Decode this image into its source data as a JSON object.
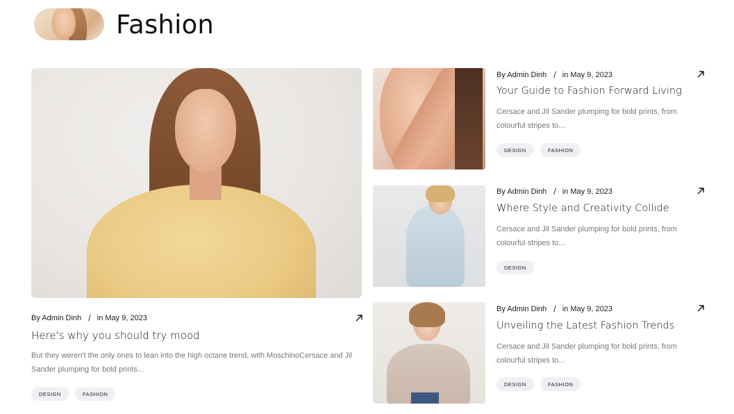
{
  "header": {
    "title": "Fashion"
  },
  "feature": {
    "author": "By Admin Dinh",
    "separator": "/",
    "date": "in May 9, 2023",
    "title": "Here's why you should try mood",
    "excerpt": "But they weren't the only ones to lean into the high octane trend, with MoschinoCersace and Jil Sander plumping for bold prints...",
    "tags": [
      "DESIGN",
      "FASHION"
    ],
    "arrow_icon": "arrow-up-right-icon"
  },
  "posts": [
    {
      "author": "By Admin Dinh",
      "separator": "/",
      "date": "in May 9, 2023",
      "title": "Your Guide to Fashion Forward Living",
      "excerpt": "Cersace and Jil Sander plumping for bold prints, from colourful stripes to...",
      "tags": [
        "DESIGN",
        "FASHION"
      ],
      "arrow_icon": "arrow-up-right-icon"
    },
    {
      "author": "By Admin Dinh",
      "separator": "/",
      "date": "in May 9, 2023",
      "title": "Where Style and Creativity Collide",
      "excerpt": "Cersace and Jil Sander plumping for bold prints, from colourful stripes to...",
      "tags": [
        "DESIGN"
      ],
      "arrow_icon": "arrow-up-right-icon"
    },
    {
      "author": "By Admin Dinh",
      "separator": "/",
      "date": "in May 9, 2023",
      "title": "Unveiling the Latest Fashion Trends",
      "excerpt": "Cersace and Jil Sander plumping for bold prints, from colourful stripes to...",
      "tags": [
        "DESIGN",
        "FASHION"
      ],
      "arrow_icon": "arrow-up-right-icon"
    }
  ],
  "colors": {
    "tag_background": "#eef0f3",
    "excerpt_text": "#777777",
    "title_text": "#111111"
  }
}
